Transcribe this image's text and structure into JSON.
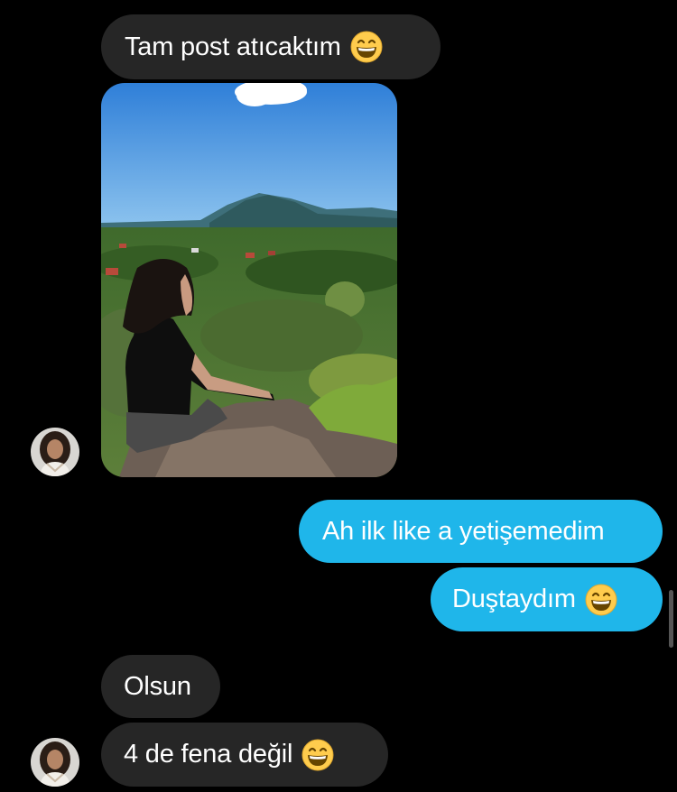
{
  "messages": [
    {
      "id": "m1",
      "direction": "incoming",
      "text": "Tam post atıcaktım",
      "emoji": "grinning-face"
    },
    {
      "id": "m2",
      "direction": "incoming",
      "type": "photo",
      "alt": ""
    },
    {
      "id": "m3",
      "direction": "outgoing",
      "text": "Ah ilk like a yetişemedim"
    },
    {
      "id": "m4",
      "direction": "outgoing",
      "text": "Duştaydım",
      "emoji": "grinning-face"
    },
    {
      "id": "m5",
      "direction": "incoming",
      "text": "Olsun"
    },
    {
      "id": "m6",
      "direction": "incoming",
      "text": "4 de fena değil",
      "emoji": "grinning-face"
    }
  ],
  "colors": {
    "background": "#000000",
    "incoming_bubble": "#262626",
    "outgoing_bubble": "#1fb6ea",
    "text": "#ffffff"
  },
  "icons": {
    "emoji": "grinning-face-emoji",
    "avatar": "contact-avatar"
  }
}
